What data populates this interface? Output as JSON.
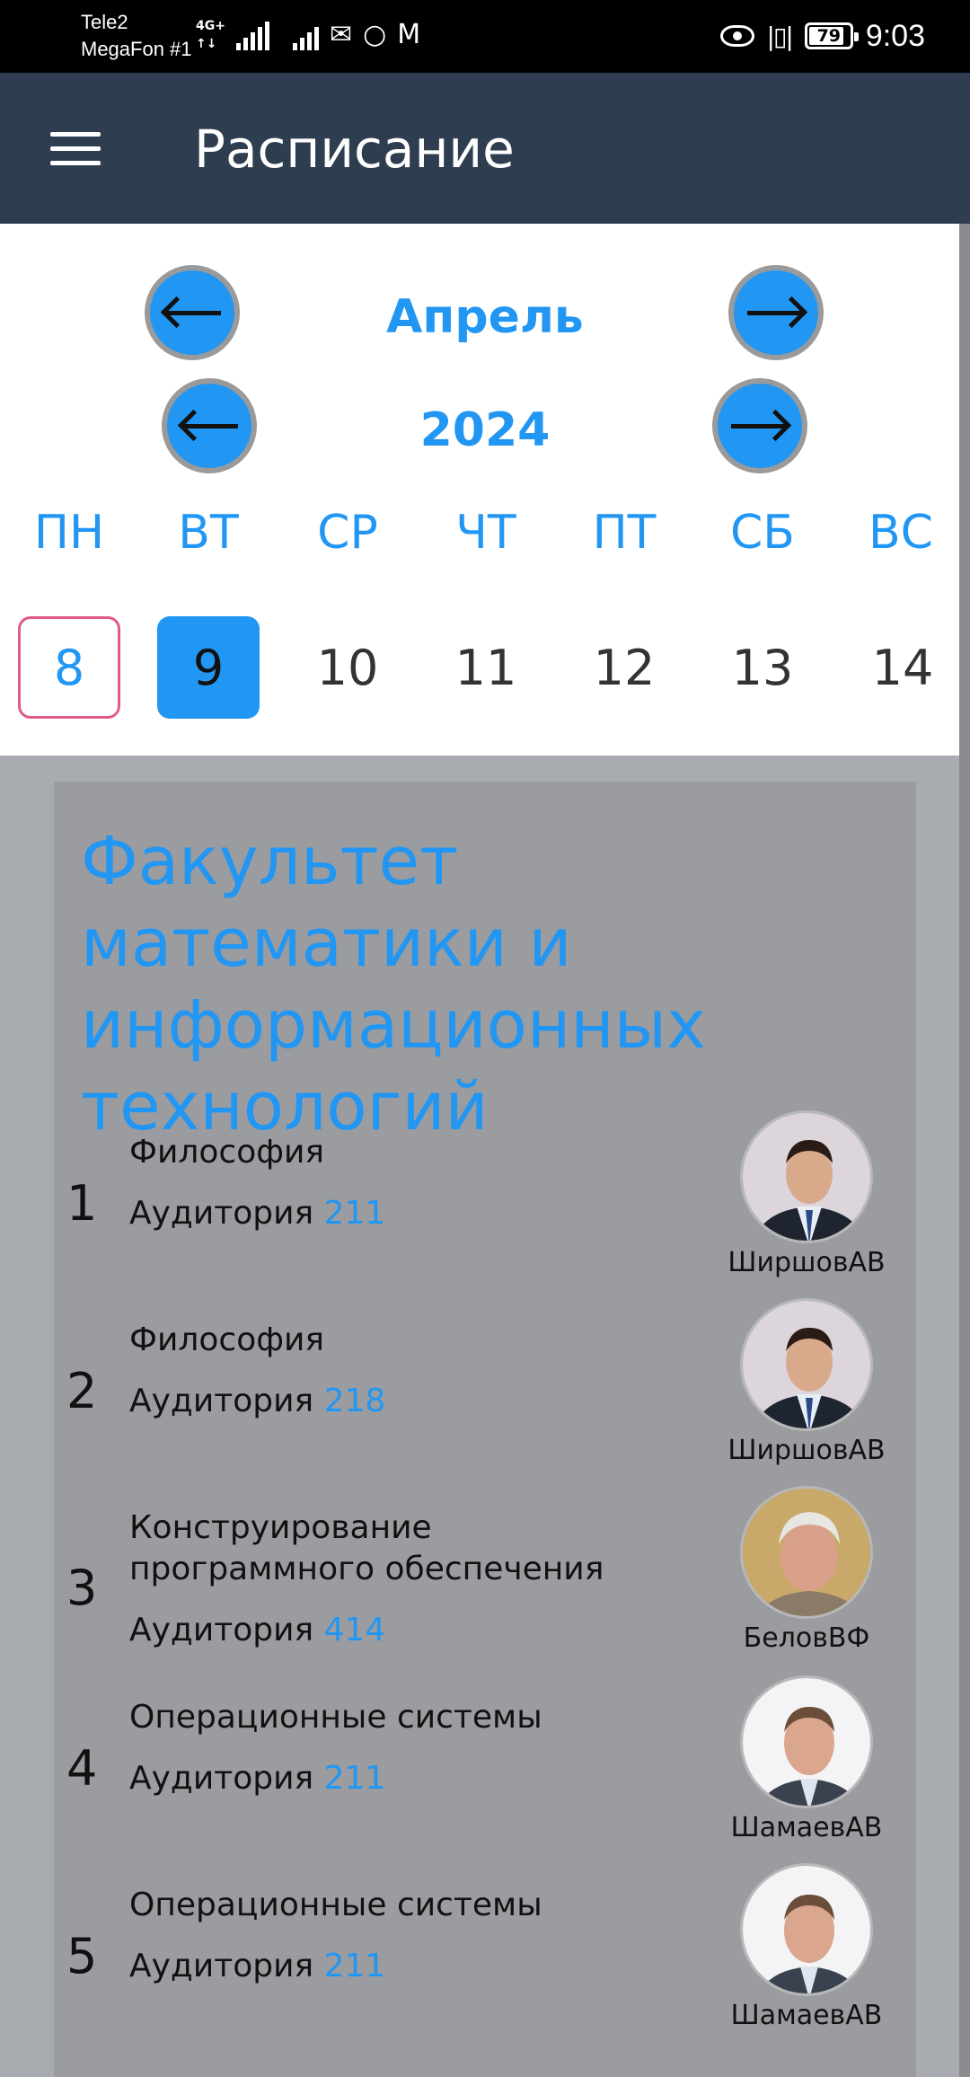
{
  "status_bar": {
    "carrier1": "Tele2",
    "carrier2": "MegaFon #1",
    "network_tag_top": "4G+",
    "network_tag_bottom": "↑↓",
    "mail_icon": "✉",
    "sync_icon": "○",
    "gmail_icon": "M",
    "battery": "79",
    "time": "9:03"
  },
  "app_bar": {
    "title": "Расписание"
  },
  "calendar": {
    "month": "Апрель",
    "year": "2024",
    "weekdays": [
      "ПН",
      "ВТ",
      "СР",
      "ЧТ",
      "ПТ",
      "СБ",
      "ВС"
    ],
    "days": [
      "8",
      "9",
      "10",
      "11",
      "12",
      "13",
      "14"
    ],
    "today_index": 0,
    "selected_index": 1,
    "accent_color": "#2196f3",
    "today_border_color": "#e05a8a"
  },
  "faculty": {
    "title": "Факультет математики и информационных технологий"
  },
  "lessons": [
    {
      "number": "1",
      "subject": "Философия",
      "room_label": "Аудитория",
      "room": "211",
      "teacher": "ШиршовАВ"
    },
    {
      "number": "2",
      "subject": "Философия",
      "room_label": "Аудитория",
      "room": "218",
      "teacher": "ШиршовАВ"
    },
    {
      "number": "3",
      "subject": "Конструирование программного обеспечения",
      "room_label": "Аудитория",
      "room": "414",
      "teacher": "БеловВФ"
    },
    {
      "number": "4",
      "subject": "Операционные системы",
      "room_label": "Аудитория",
      "room": "211",
      "teacher": "ШамаевАВ"
    },
    {
      "number": "5",
      "subject": "Операционные системы",
      "room_label": "Аудитория",
      "room": "211",
      "teacher": "ШамаевАВ"
    }
  ]
}
